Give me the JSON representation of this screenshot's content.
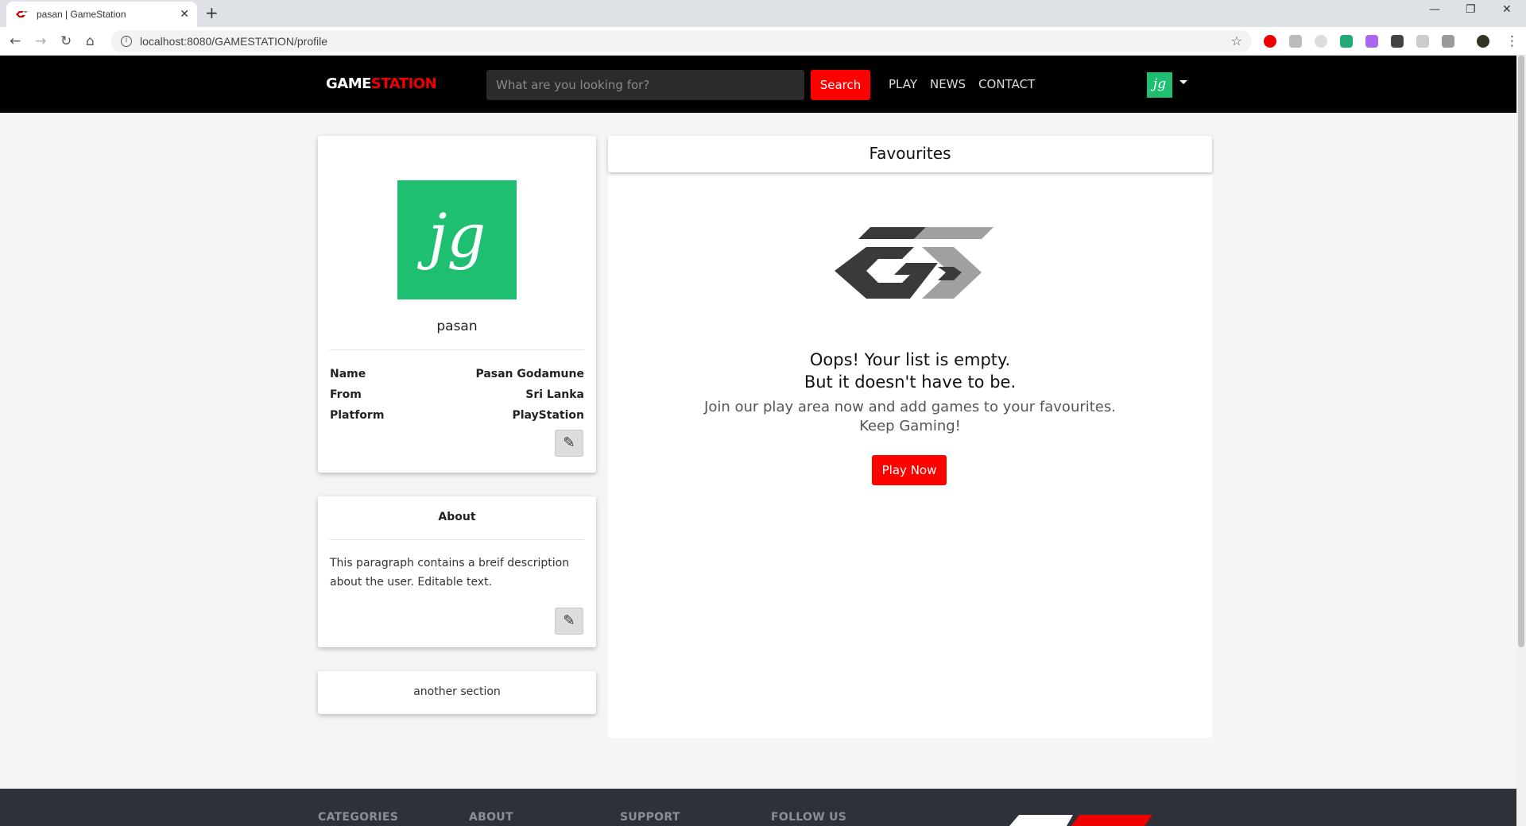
{
  "browser": {
    "tab_title": "pasan | GameStation",
    "tab_close": "✕",
    "new_tab": "+",
    "url": "localhost:8080/GAMESTATION/profile",
    "window_controls": {
      "minimize": "—",
      "restore": "❐",
      "close": "✕"
    }
  },
  "header": {
    "logo_part1": "GAME",
    "logo_part2": "STATION",
    "search_placeholder": "What are you looking for?",
    "search_button": "Search",
    "nav": [
      "PLAY",
      "NEWS",
      "CONTACT"
    ],
    "avatar_text": "jg"
  },
  "profile": {
    "avatar_text": "jg",
    "username": "pasan",
    "fields": [
      {
        "label": "Name",
        "value": "Pasan Godamune"
      },
      {
        "label": "From",
        "value": "Sri Lanka"
      },
      {
        "label": "Platform",
        "value": "PlayStation"
      }
    ],
    "edit_icon": "✎"
  },
  "about": {
    "title": "About",
    "text": "This paragraph contains a breif description about the user. Editable text.",
    "edit_icon": "✎"
  },
  "another": {
    "text": "another section"
  },
  "favourites": {
    "title": "Favourites",
    "empty_line1": "Oops! Your list is empty.",
    "empty_line2": "But it doesn't have to be.",
    "cta_line1": "Join our play area now and add games to your favourites.",
    "cta_line2": "Keep Gaming!",
    "play_button": "Play Now"
  },
  "footer": {
    "columns": [
      "CATEGORIES",
      "ABOUT",
      "SUPPORT",
      "FOLLOW US"
    ]
  },
  "colors": {
    "brand_red": "#ff0000",
    "avatar_green": "#1fbf72",
    "header_bg": "#000000",
    "footer_bg": "#2f3138"
  }
}
